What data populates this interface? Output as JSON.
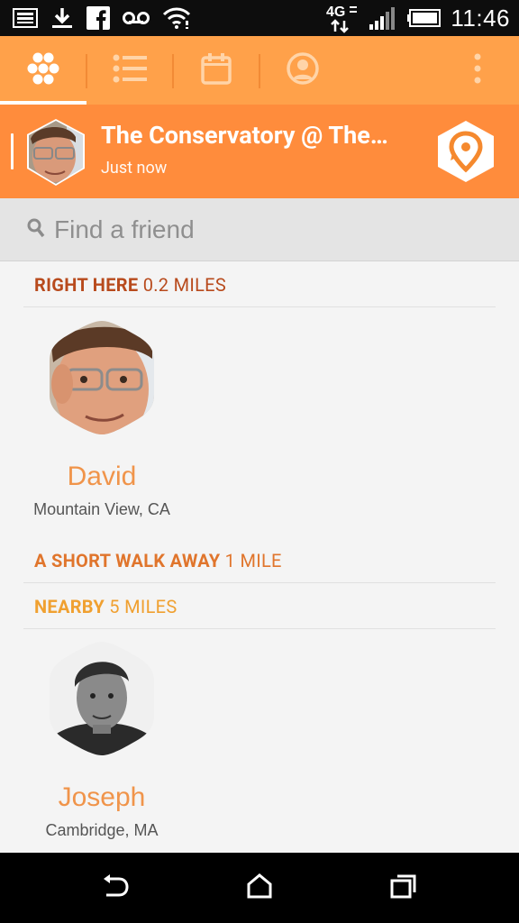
{
  "status_bar": {
    "time": "11:46",
    "network": "4G",
    "icons": [
      "gallery-icon",
      "download-icon",
      "facebook-icon",
      "voicemail-icon",
      "wifi-icon",
      "network-4g-icon",
      "signal-icon",
      "battery-icon"
    ]
  },
  "tabs": [
    {
      "name": "hexagons-icon",
      "selected": true
    },
    {
      "name": "list-icon",
      "selected": false
    },
    {
      "name": "calendar-icon",
      "selected": false
    },
    {
      "name": "profile-icon",
      "selected": false
    }
  ],
  "checkin": {
    "title": "The Conservatory @ The…",
    "time": "Just now"
  },
  "search": {
    "placeholder": "Find a friend"
  },
  "sections": [
    {
      "label": "RIGHT HERE",
      "distance": "0.2 MILES",
      "color": "#b84a1c"
    },
    {
      "label": "A SHORT WALK AWAY",
      "distance": "1 MILE",
      "color": "#e0752c"
    },
    {
      "label": "NEARBY",
      "distance": "5 MILES",
      "color": "#f0a030"
    }
  ],
  "friends": [
    {
      "name": "David",
      "location": "Mountain View, CA"
    },
    {
      "name": "Joseph",
      "location": "Cambridge, MA"
    }
  ],
  "colors": {
    "accent": "#ffa14a",
    "banner": "#ff8c3c",
    "name_color": "#f0944a"
  }
}
